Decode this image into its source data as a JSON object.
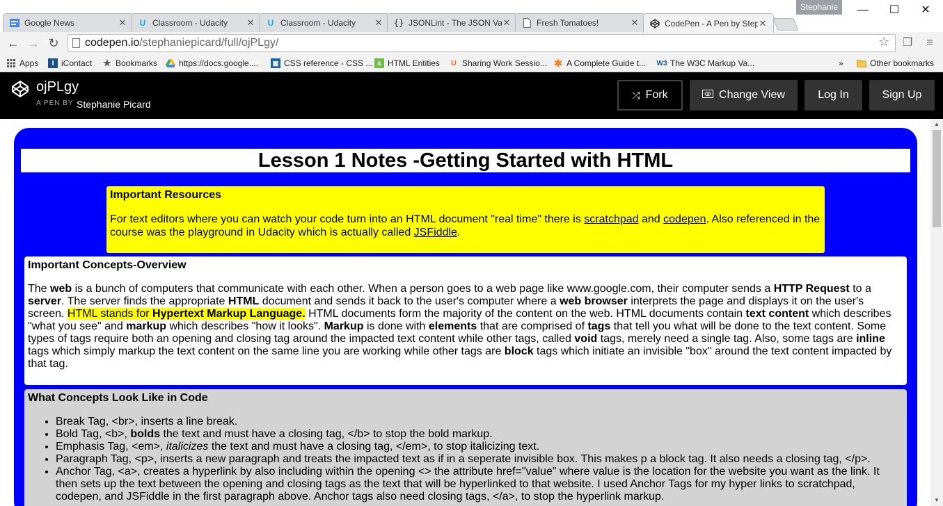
{
  "browser": {
    "tabs": [
      {
        "label": "Google News",
        "icon": "google-news-icon"
      },
      {
        "label": "Classroom - Udacity",
        "icon": "udacity-icon"
      },
      {
        "label": "Classroom - Udacity",
        "icon": "udacity-icon"
      },
      {
        "label": "JSONLint - The JSON Vali",
        "icon": "braces-icon"
      },
      {
        "label": "Fresh Tomatoes!",
        "icon": "page-icon"
      },
      {
        "label": "CodePen - A Pen by Steph",
        "icon": "codepen-icon"
      }
    ],
    "profile_name": "Stephanie",
    "url_host": "codepen.io",
    "url_path": "/stephaniepicard/full/ojPLgy/",
    "bookmarks": [
      {
        "label": "Apps"
      },
      {
        "label": "iContact"
      },
      {
        "label": "Bookmarks"
      },
      {
        "label": "https://docs.google...."
      },
      {
        "label": "CSS reference - CSS ..."
      },
      {
        "label": "HTML Entities"
      },
      {
        "label": "Sharing Work Sessio..."
      },
      {
        "label": "A Complete Guide t..."
      },
      {
        "label": "The W3C Markup Va..."
      }
    ],
    "bookmarks_overflow": "»",
    "other_bookmarks": "Other bookmarks"
  },
  "codepen": {
    "pen_title": "ojPLgy",
    "pen_by": "A PEN BY",
    "author": "Stephanie Picard",
    "fork_label": "Fork",
    "change_view_label": "Change View",
    "login_label": "Log In",
    "signup_label": "Sign Up"
  },
  "page": {
    "title": "Lesson 1 Notes -Getting Started with HTML",
    "resources": {
      "heading": "Important Resources",
      "text_1": "For text editors where you can watch your code turn into an HTML document \"real time\" there is ",
      "link_scratchpad": "scratchpad",
      "text_2": " and ",
      "link_codepen": "codepen",
      "text_3": ". Also referenced in the course was the playground in Udacity which is actually called ",
      "link_jsfiddle": "JSFiddle",
      "text_4": "."
    },
    "overview": {
      "heading": "Important Concepts-Overview",
      "t01": "The ",
      "b01": "web",
      "t02": " is a bunch of computers that communicate with each other. When a person goes to a web page like www.google.com, their computer sends a ",
      "b02": "HTTP Request",
      "t03": " to a ",
      "b03": "server",
      "t04": ". The server finds the appropriate ",
      "b04": "HTML",
      "t05": " document and sends it back to the user's computer where a ",
      "b05": "web browser",
      "t06": " interprets the page and displays it on the user's screen. ",
      "h01": "HTML stands for ",
      "h02": "Hypertext Markup Language.",
      "t07": " HTML documents form the majority of the content on the web. HTML documents contain ",
      "b06": "text content",
      "t08": " which describes \"what you see\" and ",
      "b07": "markup",
      "t09": " which describes \"how it looks\". ",
      "b08": "Markup",
      "t10": " is done with ",
      "b09": "elements",
      "t11": " that are comprised of ",
      "b10": "tags",
      "t12": " that tell you what will be done to the text content. Some types of tags require both an opening and closing tag around the impacted text content while other tags, called ",
      "b11": "void",
      "t13": " tags, merely need a single tag. Also, some tags are ",
      "b12": "inline",
      "t14": " tags which simply markup the text content on the same line you are working while other tags are ",
      "b13": "block",
      "t15": " tags which initiate an invisible \"box\" around the text content impacted by that tag."
    },
    "code_look": {
      "heading": "What Concepts Look Like in Code",
      "li1": "Break Tag, <br>, inserts a line break.",
      "li2_a": "Bold Tag, <b>, ",
      "li2_b": "bolds",
      "li2_c": " the text and must have a closing tag, </b> to stop the bold markup.",
      "li3_a": "Emphasis Tag, <em>, ",
      "li3_b": "italicizes",
      "li3_c": " the text and must have a closing tag, </em>, to stop italicizing text.",
      "li4": "Paragraph Tag, <p>, inserts a new paragraph and treats the impacted text as if in a seperate invisible box. This makes p a block tag. It also needs a closing tag, </p>.",
      "li5": "Anchor Tag, <a>, creates a hyperlink by also including within the opening <> the attribute href=\"value\" where value is the location for the website you want as the link. It then sets up the text between the opening and closing tags as the text that will be hyperlinked to that website. I used Anchor Tags for my hyper links to scratchpad, codepen, and JSFiddle in the first paragraph above. Anchor tags also need closing tags, </a>, to stop the hyperlink markup."
    }
  },
  "colors": {
    "blue_box": "#0000ff",
    "highlight": "#ffff00",
    "grey_box": "#d3d3d3"
  }
}
